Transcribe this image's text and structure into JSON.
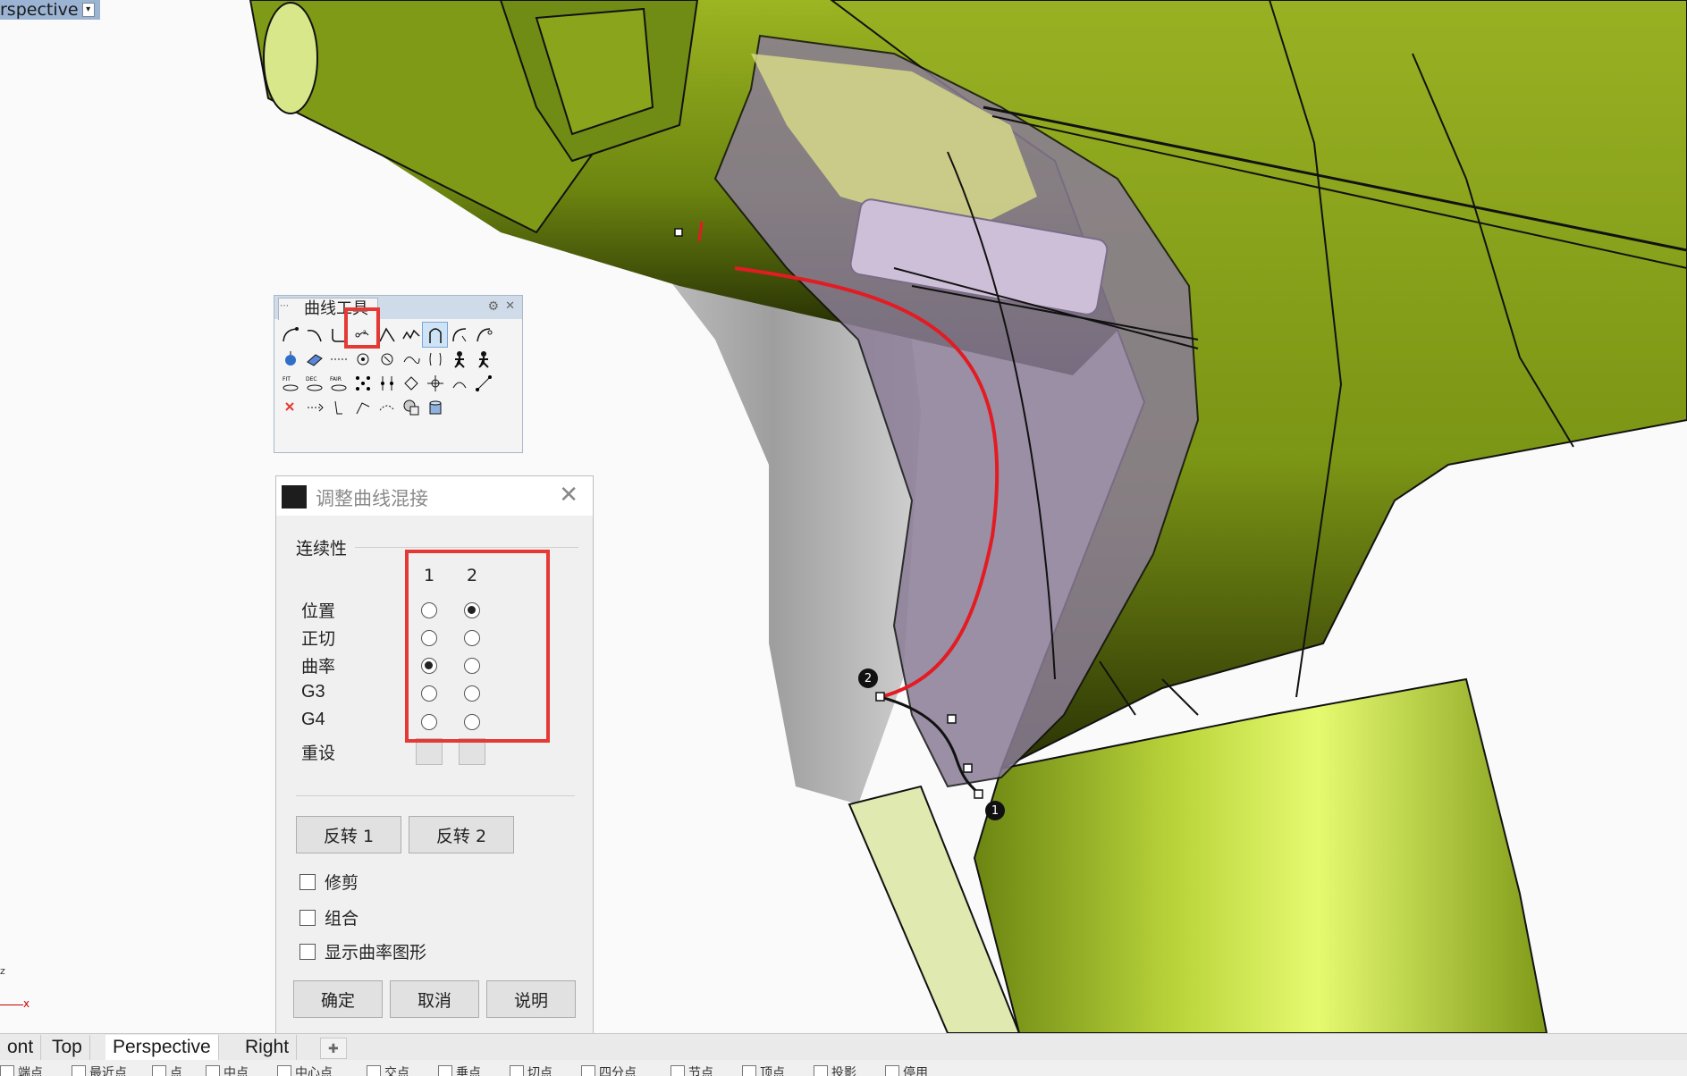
{
  "viewport": {
    "label": "rspective",
    "axis_x": "x",
    "axis_z": "z"
  },
  "curve_toolbar": {
    "title": "曲线工具",
    "gear_icon": "gear-icon",
    "close_icon": "close-icon"
  },
  "dialog": {
    "title": "调整曲线混接",
    "section_continuity": "连续性",
    "col1": "1",
    "col2": "2",
    "rows": [
      {
        "label": "位置",
        "col1": false,
        "col2": true
      },
      {
        "label": "正切",
        "col1": false,
        "col2": false
      },
      {
        "label": "曲率",
        "col1": true,
        "col2": false
      },
      {
        "label": "G3",
        "col1": false,
        "col2": false
      },
      {
        "label": "G4",
        "col1": false,
        "col2": false
      }
    ],
    "reset_label": "重设",
    "flip1": "反转 1",
    "flip2": "反转 2",
    "trim": "修剪",
    "join": "组合",
    "show_curvature": "显示曲率图形",
    "ok": "确定",
    "cancel": "取消",
    "help": "说明"
  },
  "markers": {
    "m1": "1",
    "m2": "2"
  },
  "tabs": [
    "ont",
    "Top",
    "Perspective",
    "Right"
  ],
  "active_tab": "Perspective",
  "osnap_items": [
    "端点",
    "最近点",
    "点",
    "中点",
    "中心点",
    "交点",
    "垂点",
    "切点",
    "四分点",
    "节点",
    "顶点",
    "投影",
    "停用"
  ],
  "colors": {
    "body": "#8ba61d",
    "highlight": "#e4f76a",
    "trigger": "#8b7d96",
    "red": "#e53935"
  }
}
